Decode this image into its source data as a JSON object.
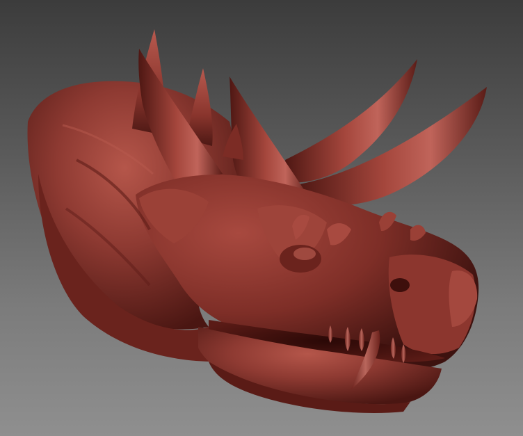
{
  "scene": {
    "subject": "sculpted-dragon-head",
    "background_top": "#3c3c3c",
    "background_bottom": "#8f8f8f",
    "material_color": "#8e3a32",
    "material_shadow": "#4a1612",
    "material_highlight": "#c76a5e"
  }
}
